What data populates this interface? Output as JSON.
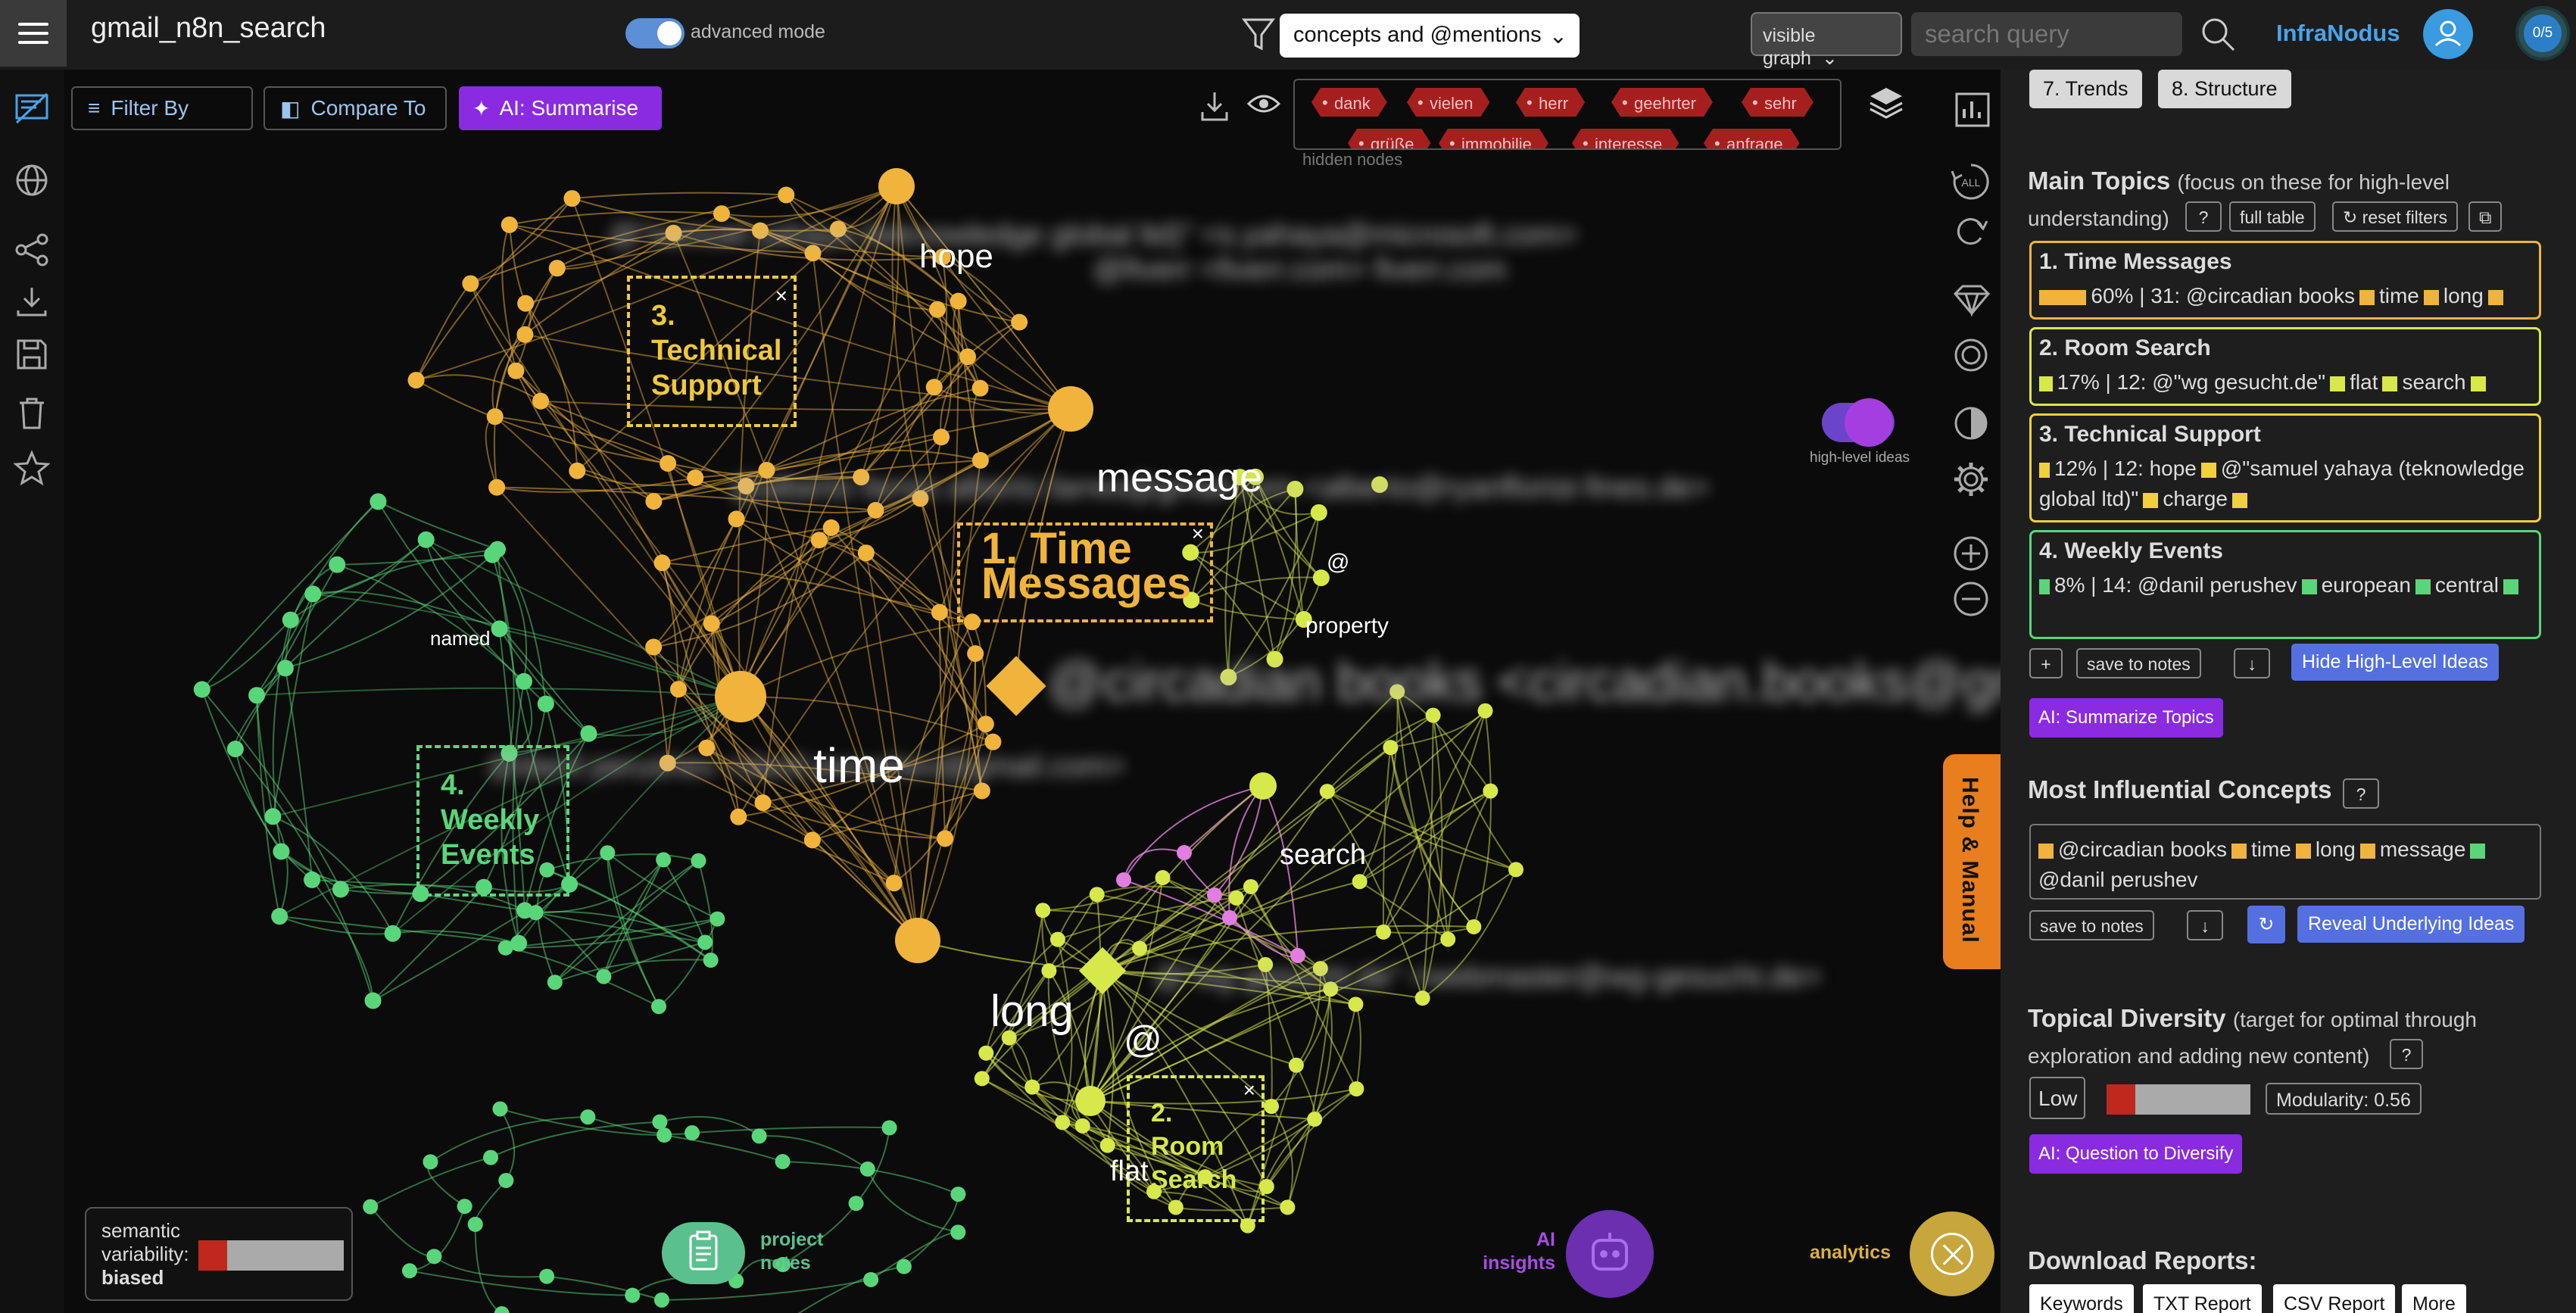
{
  "header": {
    "title": "gmail_n8n_search",
    "advanced_mode_label": "advanced mode",
    "concept_filter_value": "concepts and @mentions",
    "graph_select_value": "visible graph",
    "search_placeholder": "search query",
    "brand": "InfraNodus",
    "counter": "0/5"
  },
  "toolbar": {
    "filter_by": "Filter By",
    "compare_to": "Compare To",
    "ai_summarise": "AI: Summarise"
  },
  "hidden_nodes": {
    "label": "hidden nodes",
    "items": [
      "dank",
      "vielen",
      "herr",
      "geehrter",
      "sehr",
      "grüße",
      "immobilie",
      "interesse",
      "anfrage"
    ]
  },
  "graph": {
    "topic_boxes": {
      "time_messages": "1. Time Messages",
      "room_search": "2. Room Search",
      "technical_support": "3. Technical Support",
      "weekly_events": "4. Weekly Events"
    },
    "node_labels": {
      "hope": "hope",
      "message": "message",
      "time": "time",
      "long": "long",
      "search": "search",
      "flat": "flat",
      "at": "@",
      "at2": "@",
      "named": "named",
      "property": "property"
    },
    "colors": {
      "orange": "#f0b43c",
      "lime": "#d7e84a",
      "green": "#5ad67a",
      "pink": "#e27ee0"
    }
  },
  "right_tools": {
    "all_label": "ALL",
    "high_level_ideas_label": "high-level ideas",
    "help_manual": "Help & Manual"
  },
  "bottom": {
    "semantic_variability_label": "semantic variability:",
    "semantic_variability_value": "biased",
    "semantic_variability_level": 0.2,
    "project_notes": "project notes",
    "ai_insights": "AI insights",
    "analytics": "analytics"
  },
  "panel": {
    "tabs": [
      "7. Trends",
      "8. Structure"
    ],
    "main_topics_title": "Main Topics",
    "main_topics_sub": "(focus on these for high-level understanding)",
    "help_q": "?",
    "full_table": "full table",
    "reset_filters": "↻ reset filters",
    "topics": [
      {
        "title": "1. Time Messages",
        "meta": "60% | 31: @circadian books",
        "terms": [
          "time",
          "long"
        ],
        "color": "#f0b43c",
        "share": 0.6
      },
      {
        "title": "2. Room Search",
        "meta": "17% | 12: @\"wg gesucht.de\"",
        "terms": [
          "flat",
          "search"
        ],
        "color": "#d7e84a",
        "share": 0.17
      },
      {
        "title": "3. Technical Support",
        "meta": "12% | 12: hope",
        "terms": [
          "@\"samuel yahaya (teknowledge global ltd)\"",
          "charge"
        ],
        "color": "#f0d03c",
        "share": 0.12
      },
      {
        "title": "4. Weekly Events",
        "meta": "8% | 14: @danil perushev",
        "terms": [
          "european",
          "central"
        ],
        "color": "#5ad67a",
        "share": 0.08
      }
    ],
    "plus": "+",
    "save_to_notes": "save to notes",
    "down_arrow": "↓",
    "hide_high_level": "Hide High-Level Ideas",
    "ai_summarize_topics": "AI: Summarize Topics",
    "influential_title": "Most Influential Concepts",
    "influential_concepts": [
      "@circadian books",
      "time",
      "long",
      "message",
      "@danil perushev"
    ],
    "refresh": "↻",
    "reveal_underlying": "Reveal Underlying Ideas",
    "diversity_title": "Topical Diversity",
    "diversity_sub": "(target for optimal through exploration and adding new content)",
    "diversity_value": "Low",
    "diversity_level": 0.2,
    "modularity": "Modularity: 0.56",
    "ai_question": "AI: Question to Diversify",
    "download_title": "Download Reports:",
    "reports": [
      "Keywords",
      "TXT Report",
      "CSV Report",
      "More"
    ]
  }
}
